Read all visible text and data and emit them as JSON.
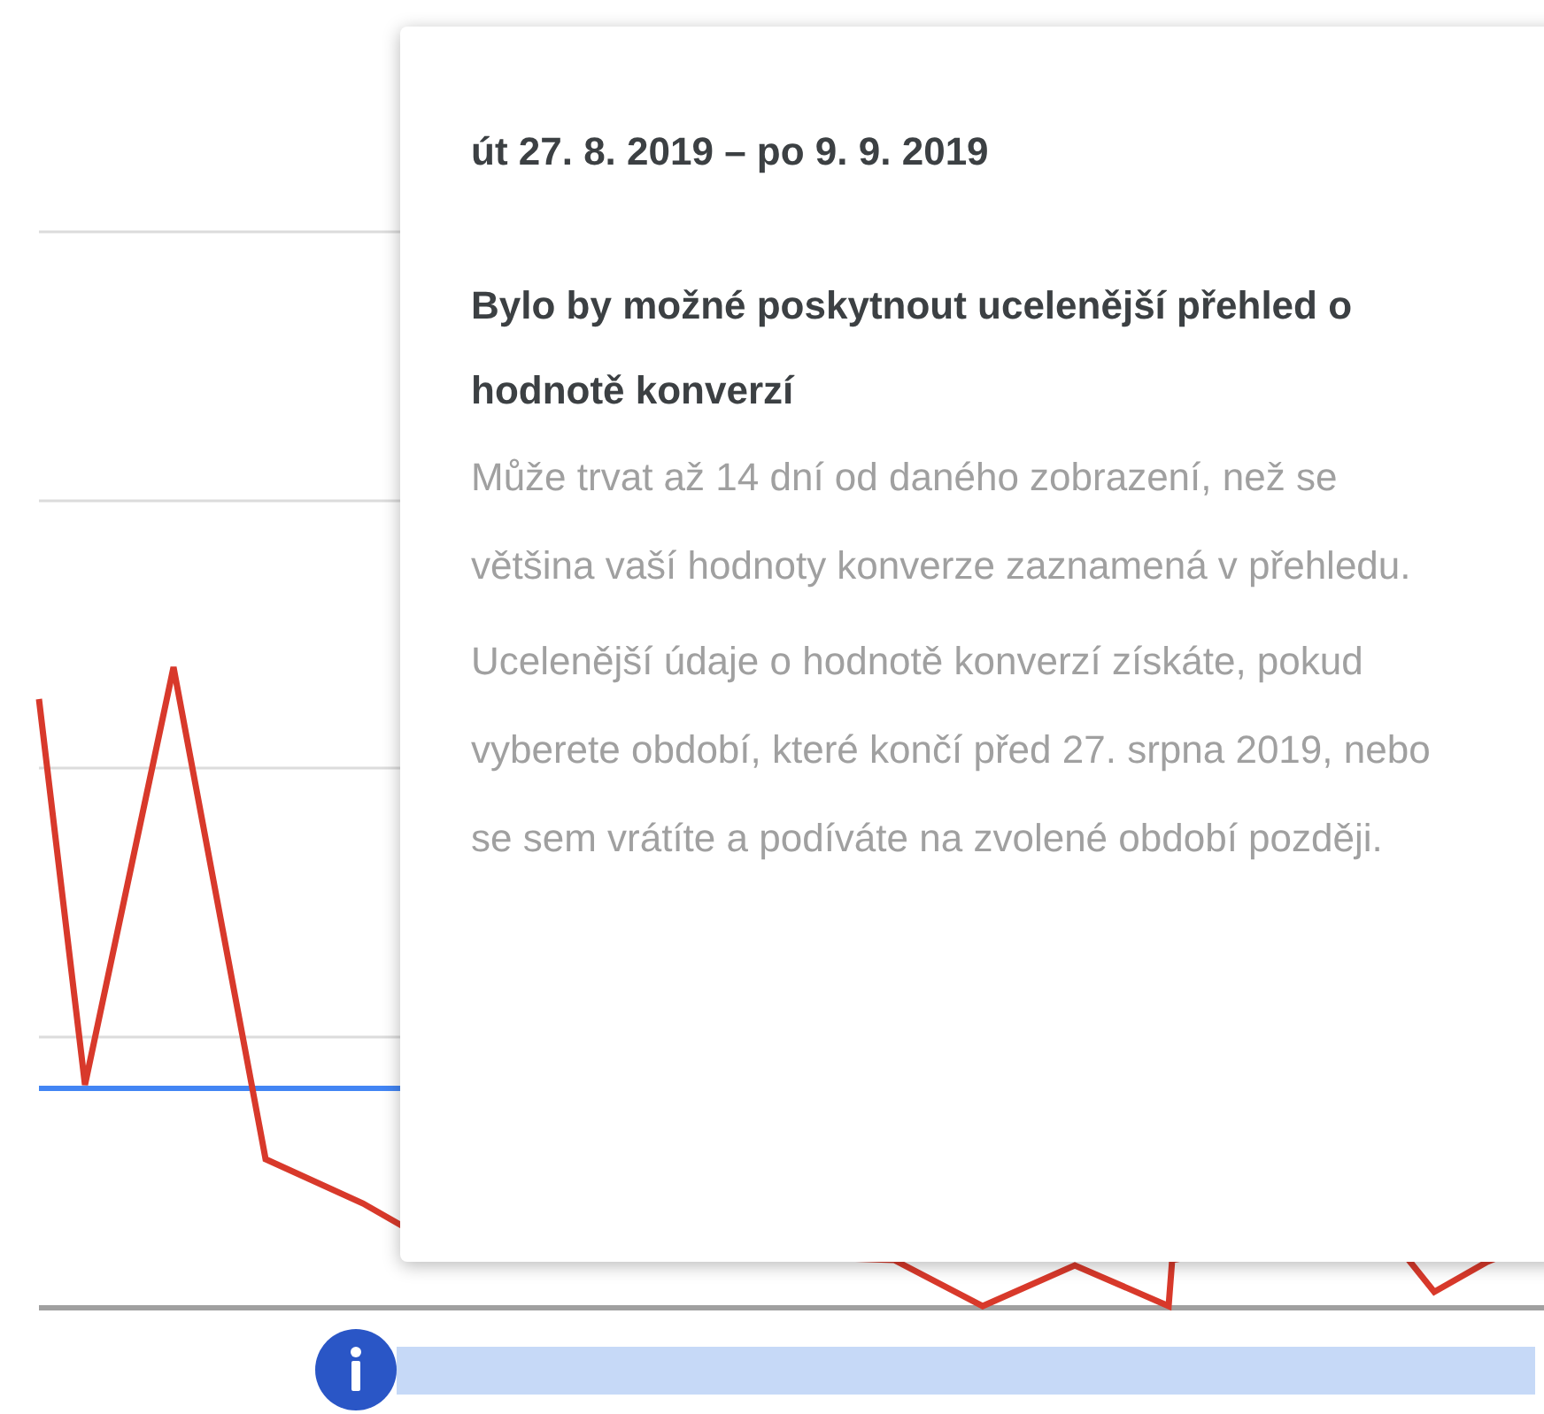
{
  "tooltip": {
    "date_range": "út 27. 8. 2019 – po 9. 9. 2019",
    "heading": "Bylo by možné poskytnout ucelenější přehled o hodnotě konverzí",
    "paragraphs": [
      "Může trvat až 14 dní od daného zobrazení, než se většina vaší hodnoty konverze zaznamená v přehledu.",
      "Ucelenější údaje o hodnotě konverzí získáte, pokud vyberete období, které končí před 27. srpna 2019, nebo se sem vrátíte a podíváte na zvolené období později."
    ]
  }
}
